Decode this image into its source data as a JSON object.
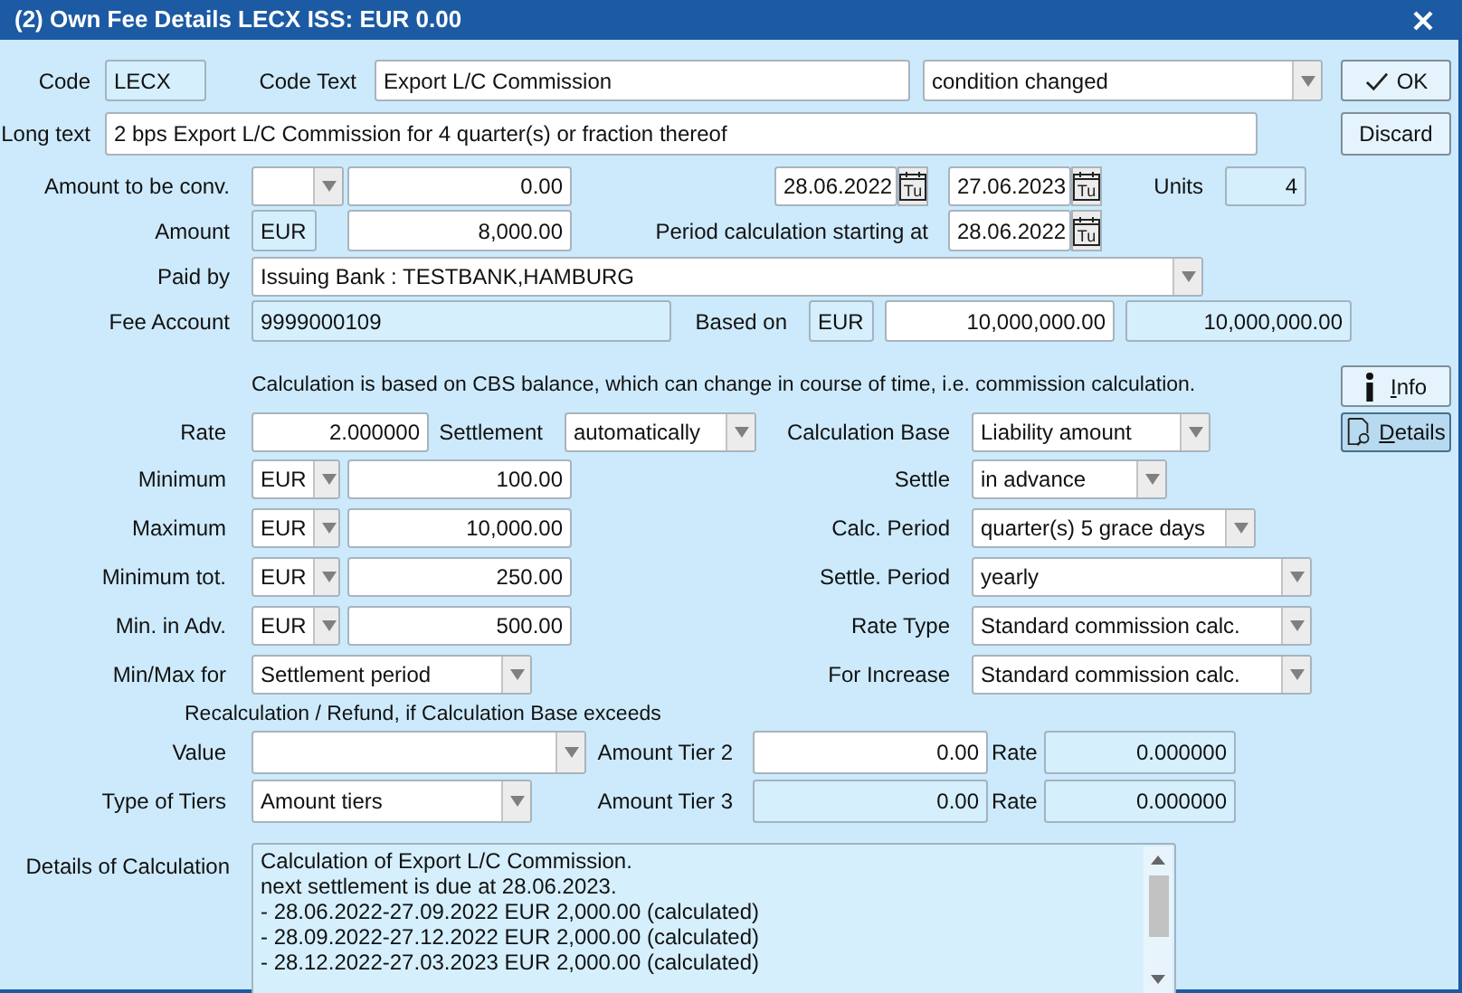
{
  "window": {
    "title": "(2) Own Fee Details LECX ISS: EUR 0.00"
  },
  "rows": [
    [
      {
        "kind": "label",
        "text": "Code"
      },
      {
        "kind": "readonly",
        "value": "LECX"
      },
      {
        "kind": "label",
        "text": "Code Text"
      },
      {
        "kind": "text",
        "value": "Export L/C Commission"
      },
      {
        "kind": "dropdown",
        "value": "condition changed"
      },
      {
        "kind": "ok",
        "label": "OK",
        "active": false
      }
    ],
    [
      {
        "kind": "label",
        "text": "Long text"
      },
      {
        "kind": "text",
        "value": "2 bps Export L/C Commission for 4 quarter(s) or fraction thereof"
      },
      {
        "kind": "discard",
        "label": "Discard",
        "active": false
      }
    ],
    [
      {
        "kind": "label",
        "text": "Amount to be conv."
      },
      {
        "kind": "dropdown"
      },
      {
        "kind": "text",
        "value": "0.00",
        "right_aligned": true
      },
      {
        "kind": "date",
        "value": "28.06.2022",
        "icon_text": "Tu"
      },
      {
        "kind": "date",
        "value": "27.06.2023",
        "icon_text": "Tu"
      },
      {
        "kind": "label",
        "text": "Units"
      },
      {
        "kind": "readonly",
        "value": "4",
        "right_aligned": true
      }
    ],
    [
      {
        "kind": "label",
        "text": "Amount"
      },
      {
        "kind": "readonly",
        "value": "EUR"
      },
      {
        "kind": "text",
        "value": "8,000.00",
        "right_aligned": true
      },
      {
        "kind": "label",
        "text": "Period calculation starting at"
      },
      {
        "kind": "date",
        "value": "28.06.2022",
        "icon_text": "Tu"
      }
    ],
    [
      {
        "kind": "label",
        "text": "Paid by"
      },
      {
        "kind": "dropdown",
        "value": "Issuing Bank : TESTBANK,HAMBURG"
      }
    ],
    [
      {
        "kind": "label",
        "text": "Fee Account"
      },
      {
        "kind": "readonly",
        "value": "9999000109"
      },
      {
        "kind": "label",
        "text": "Based on"
      },
      {
        "kind": "readonly",
        "value": "EUR"
      },
      {
        "kind": "text",
        "value": "10,000,000.00",
        "right_aligned": true
      },
      {
        "kind": "readonly",
        "value": "10,000,000.00",
        "right_aligned": true
      }
    ],
    [
      {
        "kind": "note",
        "text": "Calculation is based on CBS balance, which can change in course of time, i.e. commission calculation."
      },
      {
        "kind": "info",
        "label": "Info",
        "active": false
      }
    ],
    [
      {
        "kind": "label",
        "text": "Rate"
      },
      {
        "kind": "text",
        "value": "2.000000",
        "right_aligned": true
      },
      {
        "kind": "label",
        "text": "Settlement"
      },
      {
        "kind": "dropdown",
        "value": "automatically"
      },
      {
        "kind": "label",
        "text": "Calculation Base"
      },
      {
        "kind": "dropdown",
        "value": "Liability amount"
      },
      {
        "kind": "details",
        "label": "Details",
        "active": true
      }
    ],
    [
      {
        "kind": "label",
        "text": "Minimum"
      },
      {
        "kind": "dropdown",
        "value": "EUR"
      },
      {
        "kind": "text",
        "value": "100.00",
        "right_aligned": true
      },
      {
        "kind": "label",
        "text": "Settle"
      },
      {
        "kind": "dropdown",
        "value": "in advance"
      }
    ],
    [
      {
        "kind": "label",
        "text": "Maximum"
      },
      {
        "kind": "dropdown",
        "value": "EUR"
      },
      {
        "kind": "text",
        "value": "10,000.00",
        "right_aligned": true
      },
      {
        "kind": "label",
        "text": "Calc. Period"
      },
      {
        "kind": "dropdown",
        "value": "quarter(s) 5 grace days"
      }
    ],
    [
      {
        "kind": "label",
        "text": "Minimum tot."
      },
      {
        "kind": "dropdown",
        "value": "EUR"
      },
      {
        "kind": "text",
        "value": "250.00",
        "right_aligned": true
      },
      {
        "kind": "label",
        "text": "Settle. Period"
      },
      {
        "kind": "dropdown",
        "value": "yearly"
      }
    ],
    [
      {
        "kind": "label",
        "text": "Min. in Adv."
      },
      {
        "kind": "dropdown",
        "value": "EUR"
      },
      {
        "kind": "text",
        "value": "500.00",
        "right_aligned": true
      },
      {
        "kind": "label",
        "text": "Rate Type"
      },
      {
        "kind": "dropdown",
        "value": "Standard commission calc."
      }
    ],
    [
      {
        "kind": "label",
        "text": "Min/Max for"
      },
      {
        "kind": "dropdown",
        "value": "Settlement period"
      },
      {
        "kind": "label",
        "text": "For Increase"
      },
      {
        "kind": "dropdown",
        "value": "Standard commission calc."
      }
    ],
    [
      {
        "kind": "note",
        "text": "Recalculation / Refund, if Calculation Base exceeds"
      }
    ],
    [
      {
        "kind": "label",
        "text": "Value"
      },
      {
        "kind": "dropdown"
      },
      {
        "kind": "label",
        "text": "Amount Tier 2"
      },
      {
        "kind": "text",
        "value": "0.00",
        "right_aligned": true
      },
      {
        "kind": "label",
        "text": "Rate",
        "left_aligned": true
      },
      {
        "kind": "readonly",
        "value": "0.000000",
        "right_aligned": true
      }
    ],
    [
      {
        "kind": "label",
        "text": "Type of Tiers"
      },
      {
        "kind": "dropdown",
        "value": "Amount tiers"
      },
      {
        "kind": "label",
        "text": "Amount Tier 3"
      },
      {
        "kind": "readonly",
        "value": "0.00",
        "right_aligned": true
      },
      {
        "kind": "label",
        "text": "Rate",
        "left_aligned": true
      },
      {
        "kind": "readonly",
        "value": "0.000000",
        "right_aligned": true
      }
    ]
  ],
  "details": {
    "label": "Details of Calculation",
    "lines": [
      "Calculation of Export L/C Commission.",
      "next settlement is due at 28.06.2023.",
      "- 28.06.2022-27.09.2022 EUR 2,000.00 (calculated)",
      "- 28.09.2022-27.12.2022 EUR 2,000.00 (calculated)",
      "- 28.12.2022-27.03.2023 EUR 2,000.00 (calculated)"
    ]
  }
}
